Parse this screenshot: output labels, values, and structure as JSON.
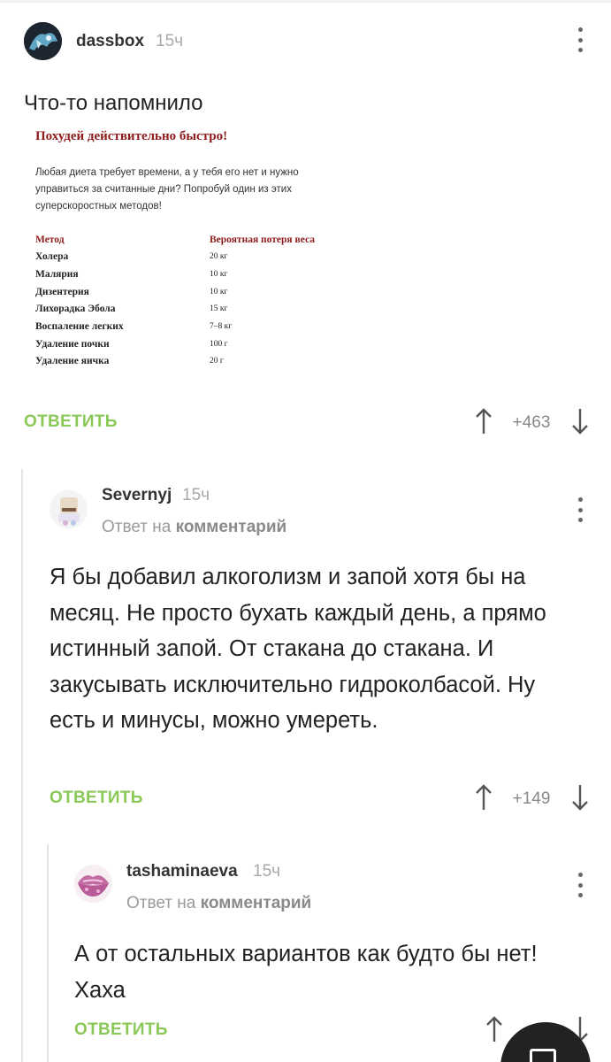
{
  "comments": [
    {
      "author": "dassbox",
      "time": "15ч",
      "text": "Что-то напомнило",
      "reply_label": "ОТВЕТИТЬ",
      "rating": "+463"
    },
    {
      "author": "Severnyj",
      "time": "15ч",
      "reply_to_prefix": "Ответ на",
      "reply_to_target": "комментарий",
      "text": "Я бы добавил алкоголизм и запой хотя бы на месяц. Не просто бухать каждый день, а прямо истинный запой. От стакана до стакана. И закусывать исключительно гидроколбасой. Ну есть и минусы, можно умереть.",
      "reply_label": "ОТВЕТИТЬ",
      "rating": "+149"
    },
    {
      "author": "tashaminaeva",
      "time": "15ч",
      "reply_to_prefix": "Ответ на",
      "reply_to_target": "комментарий",
      "text": "А от остальных вариантов как будто бы нет! Хаха",
      "reply_label": "ОТВЕТИТЬ"
    }
  ],
  "diet_image": {
    "title": "Похудей действительно быстро!",
    "intro": "Любая диета требует времени, а у тебя его нет и нужно управиться за считанные дни? Попробуй один из этих суперскоростных методов!",
    "col_method": "Метод",
    "col_loss": "Вероятная потеря веса",
    "rows": [
      {
        "method": "Холера",
        "loss": "20 кг"
      },
      {
        "method": "Малярия",
        "loss": "10 кг"
      },
      {
        "method": "Дизентерия",
        "loss": "10 кг"
      },
      {
        "method": "Лихорадка Эбола",
        "loss": "15 кг"
      },
      {
        "method": "Воспаление легких",
        "loss": "7–8 кг"
      },
      {
        "method": "Удаление почки",
        "loss": "100 г"
      },
      {
        "method": "Удаление яичка",
        "loss": "20 г"
      }
    ]
  },
  "icons": {
    "more": "more-vertical-icon",
    "up": "arrow-up-icon",
    "down": "arrow-down-icon",
    "fab": "comment-icon"
  },
  "colors": {
    "accent": "#8ac858",
    "diet_red": "#8e1b1b"
  }
}
